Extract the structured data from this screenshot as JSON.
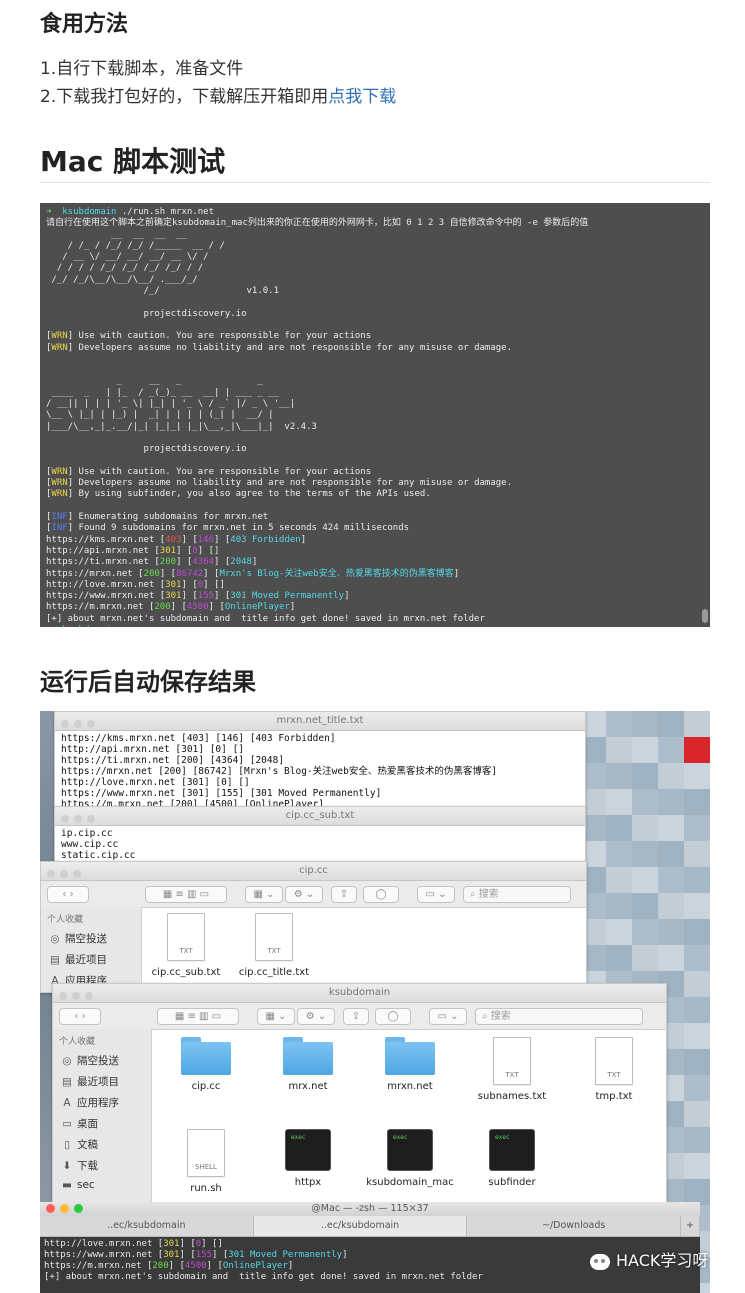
{
  "section1": {
    "heading": "食用方法",
    "step1": "1.自行下载脚本，准备文件",
    "step2_prefix": "2.下载我打包好的，下载解压开箱即用",
    "step2_link": "点我下载"
  },
  "section2": {
    "heading": "Mac 脚本测试"
  },
  "terminal1": {
    "prompt_arrow": "➜",
    "prompt_dir": "ksubdomain",
    "command": " ./run.sh mrxn.net",
    "note": "请自行在使用这个脚本之前确定ksubdomain_mac列出来的你正在使用的外网网卡，比如 0 1 2 3 自信修改命令中的 -e 参数后的值",
    "version1": "v1.0.1",
    "site1": "projectdiscovery.io",
    "warn1a": "Use with caution. You are responsible for your actions",
    "warn1b": "Developers assume no liability and are not responsible for any misuse or damage.",
    "version2": "v2.4.3",
    "site2": "projectdiscovery.io",
    "warn2a": "Use with caution. You are responsible for your actions",
    "warn2b": "Developers assume no liability and are not responsible for any misuse or damage.",
    "warn2c": "By using subfinder, you also agree to the terms of the APIs used.",
    "wrn_tag": "WRN",
    "inf_tag": "INF",
    "inf1": "Enumerating subdomains for mrxn.net",
    "inf2": "Found 9 subdomains for mrxn.net in 5 seconds 424 milliseconds",
    "results": [
      {
        "url": "https://kms.mrxn.net",
        "code": "403",
        "size": "146",
        "title": "403 Forbidden"
      },
      {
        "url": "http://api.mrxn.net",
        "code": "301",
        "size": "0",
        "title": ""
      },
      {
        "url": "https://ti.mrxn.net",
        "code": "200",
        "size": "4364",
        "title": "2048"
      },
      {
        "url": "https://mrxn.net",
        "code": "200",
        "size": "86742",
        "title": "Mrxn's Blog-关注web安全、热爱黑客技术的伪黑客博客"
      },
      {
        "url": "http://love.mrxn.net",
        "code": "301",
        "size": "0",
        "title": ""
      },
      {
        "url": "https://www.mrxn.net",
        "code": "301",
        "size": "155",
        "title": "301 Moved Permanently"
      },
      {
        "url": "https://m.mrxn.net",
        "code": "200",
        "size": "4500",
        "title": "OnlinePlayer"
      }
    ],
    "done": "[+] about mrxn.net's subdomain and  title info get done! saved in mrxn.net folder",
    "prompt2_dir": "ksubdomain"
  },
  "section3": {
    "heading": "运行后自动保存结果"
  },
  "title_window": {
    "title": "mrxn.net_title.txt",
    "lines": [
      "https://kms.mrxn.net [403] [146] [403 Forbidden]",
      "http://api.mrxn.net [301] [0] []",
      "https://ti.mrxn.net [200] [4364] [2048]",
      "https://mrxn.net [200] [86742] [Mrxn's Blog-关注web安全、热爱黑客技术的伪黑客博客]",
      "http://love.mrxn.net [301] [0] []",
      "https://www.mrxn.net [301] [155] [301 Moved Permanently]",
      "https://m.mrxn.net [200] [4500] [OnlinePlayer]"
    ]
  },
  "sub_window": {
    "title": "cip.cc_sub.txt",
    "lines": [
      "ip.cip.cc",
      "www.cip.cc",
      "static.cip.cc"
    ]
  },
  "finder1": {
    "title": "cip.cc",
    "search": "搜索",
    "sidebar_header": "个人收藏",
    "sidebar": [
      {
        "icon": "airdrop-icon",
        "glyph": "◎",
        "label": "隔空投送"
      },
      {
        "icon": "recents-icon",
        "glyph": "▤",
        "label": "最近项目"
      },
      {
        "icon": "apps-icon",
        "glyph": "A",
        "label": "应用程序"
      }
    ],
    "files": [
      {
        "name": "cip.cc_sub.txt",
        "kind": "TXT"
      },
      {
        "name": "cip.cc_title.txt",
        "kind": "TXT"
      }
    ]
  },
  "finder2": {
    "title": "ksubdomain",
    "search": "搜索",
    "sidebar_header": "个人收藏",
    "sidebar": [
      {
        "icon": "airdrop-icon",
        "glyph": "◎",
        "label": "隔空投送"
      },
      {
        "icon": "recents-icon",
        "glyph": "▤",
        "label": "最近项目"
      },
      {
        "icon": "apps-icon",
        "glyph": "A",
        "label": "应用程序"
      },
      {
        "icon": "desktop-icon",
        "glyph": "▭",
        "label": "桌面"
      },
      {
        "icon": "documents-icon",
        "glyph": "▯",
        "label": "文稿"
      },
      {
        "icon": "downloads-icon",
        "glyph": "⬇",
        "label": "下载"
      },
      {
        "icon": "folder-icon",
        "glyph": "▬",
        "label": "sec"
      }
    ],
    "files": [
      {
        "name": "cip.cc",
        "kind": "folder"
      },
      {
        "name": "mrx.net",
        "kind": "folder"
      },
      {
        "name": "mrxn.net",
        "kind": "folder"
      },
      {
        "name": "subnames.txt",
        "kind": "TXT"
      },
      {
        "name": "tmp.txt",
        "kind": "TXT"
      },
      {
        "name": "run.sh",
        "kind": "SHELL"
      },
      {
        "name": "httpx",
        "kind": "exec"
      },
      {
        "name": "ksubdomain_mac",
        "kind": "exec"
      },
      {
        "name": "subfinder",
        "kind": "exec"
      }
    ]
  },
  "terminal2": {
    "title": "@Mac — -zsh — 115×37",
    "tabs": [
      "..ec/ksubdomain",
      "..ec/ksubdomain",
      "~/Downloads"
    ],
    "tab_add": "+",
    "lines": [
      {
        "url": "http://love.mrxn.net",
        "code": "301",
        "size": "0",
        "title": ""
      },
      {
        "url": "https://www.mrxn.net",
        "code": "301",
        "size": "155",
        "title": "301 Moved Permanently"
      },
      {
        "url": "https://m.mrxn.net",
        "code": "200",
        "size": "4500",
        "title": "OnlinePlayer"
      }
    ],
    "done": "[+] about mrxn.net's subdomain and  title info get done! saved in mrxn.net folder"
  },
  "watermark": "HACK学习呀",
  "colors": {
    "link": "#2f6fb6",
    "terminal_bg": "#4e4e4e",
    "green": "#6bdc4c",
    "cyan": "#52d8e8",
    "yellow": "#e8d84a",
    "magenta": "#c04bd4",
    "red": "#ea5252"
  }
}
